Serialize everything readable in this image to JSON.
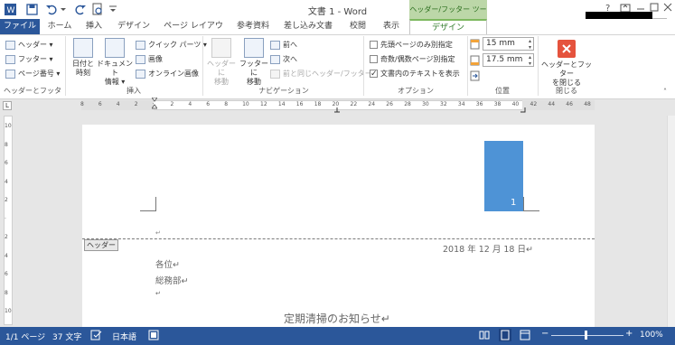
{
  "window": {
    "title": "文書 1 - Word",
    "context_title": "ヘッダー/フッター ツール",
    "help": "?",
    "controls": [
      "🗖",
      "—",
      "☐",
      "✕"
    ]
  },
  "tabs": [
    "ファイル",
    "ホーム",
    "挿入",
    "デザイン",
    "ページ レイアウト",
    "参考資料",
    "差し込み文書",
    "校閲",
    "表示",
    "デザイン"
  ],
  "ribbon": {
    "hf": {
      "header": "ヘッダー",
      "footer": "フッター",
      "page_number": "ページ番号",
      "group": "ヘッダーとフッター"
    },
    "insert": {
      "datetime_1": "日付と",
      "datetime_2": "時刻",
      "docinfo_1": "ドキュメント",
      "docinfo_2": "情報",
      "quickparts": "クイック パーツ",
      "picture": "画像",
      "online_picture": "オンライン画像",
      "group": "挿入"
    },
    "nav": {
      "goto_header_1": "ヘッダーに",
      "goto_header_2": "移動",
      "goto_footer_1": "フッターに",
      "goto_footer_2": "移動",
      "previous": "前へ",
      "next": "次へ",
      "link_previous": "前と同じヘッダー/フッター",
      "group": "ナビゲーション"
    },
    "options": {
      "first_page": "先頭ページのみ別指定",
      "odd_even": "奇数/偶数ページ別指定",
      "show_text": "文書内のテキストを表示",
      "group": "オプション"
    },
    "position": {
      "header_pos": "15 mm",
      "footer_pos": "17.5 mm",
      "group": "位置"
    },
    "close": {
      "label_1": "ヘッダーとフッター",
      "label_2": "を閉じる",
      "group": "閉じる"
    }
  },
  "ruler": {
    "h_ticks": [
      "8",
      "6",
      "4",
      "2",
      "",
      "2",
      "4",
      "6",
      "8",
      "10",
      "12",
      "14",
      "16",
      "18",
      "20",
      "22",
      "24",
      "26",
      "28",
      "30",
      "32",
      "34",
      "36",
      "38",
      "40",
      "42",
      "44",
      "46",
      "48"
    ],
    "v_ticks": [
      "10",
      "8",
      "6",
      "4",
      "2",
      "",
      "2",
      "4",
      "6",
      "8",
      "10"
    ]
  },
  "document": {
    "header_tag": "ヘッダー",
    "page_number": "1",
    "date": "2018 年 12 月 18 日↵",
    "line1": "各位↵",
    "line2": "総務部↵",
    "line3": "↵",
    "line4": "↵",
    "title": "定期清掃のお知らせ↵"
  },
  "status": {
    "page": "1/1 ページ",
    "words": "37 文字",
    "language": "日本語",
    "zoom": "100%"
  },
  "colors": {
    "accent": "#2b579a",
    "context": "#7db85f",
    "page_box": "#4e93d6",
    "close_button": "#e5533d"
  }
}
